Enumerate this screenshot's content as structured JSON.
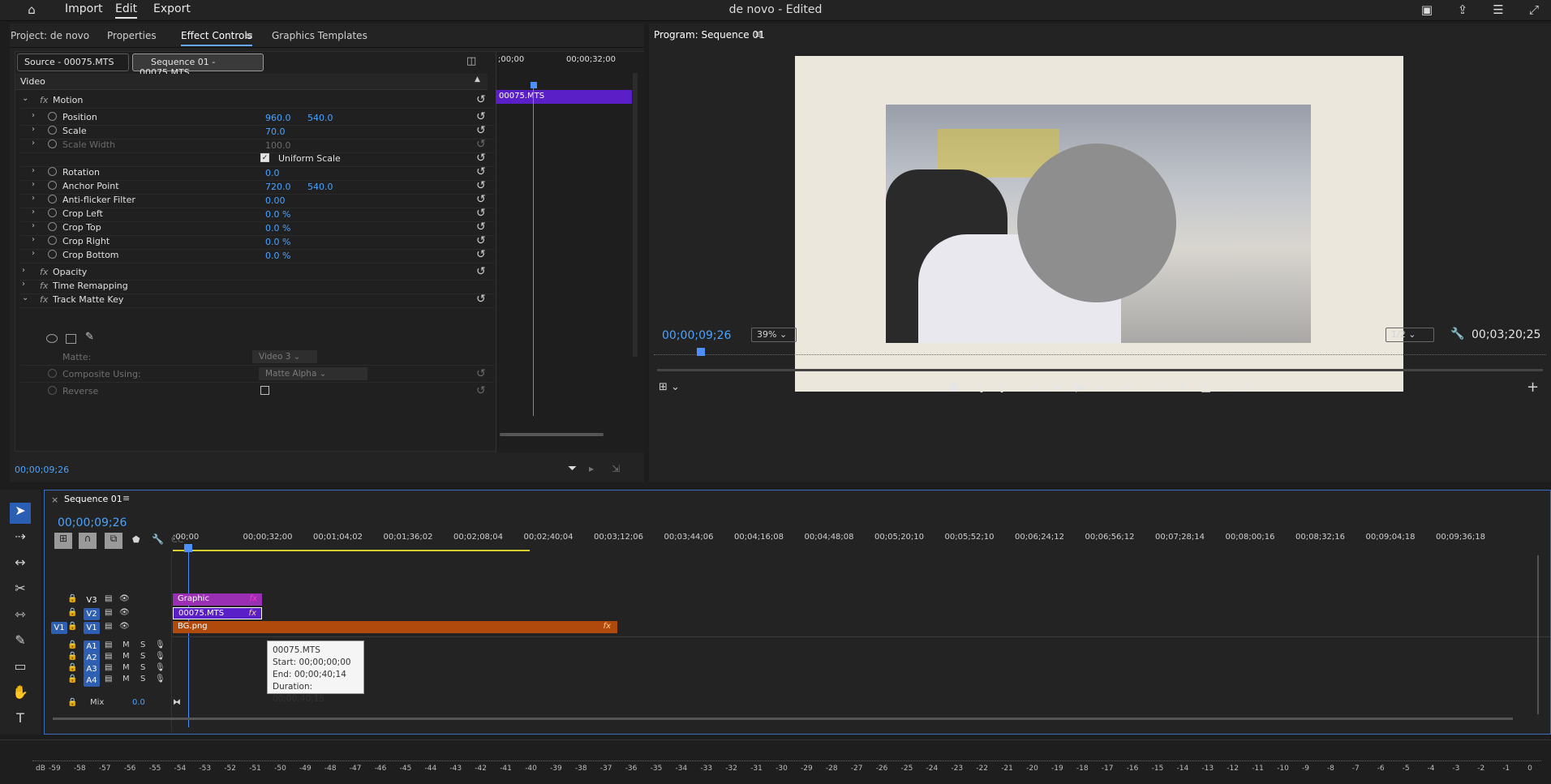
{
  "topbar": {
    "home_icon": "home-icon",
    "menu": [
      "Import",
      "Edit",
      "Export"
    ],
    "active": "Edit",
    "title": "de novo - Edited"
  },
  "left_panel": {
    "tabs": [
      "Project: de novo",
      "Properties",
      "Effect Controls",
      "Graphics Templates"
    ],
    "active_tab": "Effect Controls",
    "source_btn": "Source - 00075.MTS",
    "sequence_btn": "Sequence 01 - 00075.MTS",
    "section": "Video",
    "ec_time_start": ";00;00",
    "ec_time_end": "00;00;32;00",
    "ec_clip": "00075.MTS",
    "rows": [
      {
        "label": "Motion",
        "fx": true
      },
      {
        "label": "Position",
        "v1": "960.0",
        "v2": "540.0"
      },
      {
        "label": "Scale",
        "v1": "70.0"
      },
      {
        "label": "Scale Width",
        "v1": "100.0",
        "dim": true
      },
      {
        "label": "Uniform Scale",
        "checkbox": true
      },
      {
        "label": "Rotation",
        "v1": "0.0"
      },
      {
        "label": "Anchor Point",
        "v1": "720.0",
        "v2": "540.0"
      },
      {
        "label": "Anti-flicker Filter",
        "v1": "0.00"
      },
      {
        "label": "Crop Left",
        "v1": "0.0 %"
      },
      {
        "label": "Crop Top",
        "v1": "0.0 %"
      },
      {
        "label": "Crop Right",
        "v1": "0.0 %"
      },
      {
        "label": "Crop Bottom",
        "v1": "0.0 %"
      },
      {
        "label": "Opacity",
        "fx": true
      },
      {
        "label": "Time Remapping",
        "fx": true
      },
      {
        "label": "Track Matte Key",
        "fx": true
      }
    ],
    "matte_label": "Matte:",
    "matte_value": "Video 3",
    "composite_label": "Composite Using:",
    "composite_value": "Matte Alpha",
    "reverse_label": "Reverse",
    "footer_time": "00;00;09;26"
  },
  "program": {
    "title": "Program: Sequence 01",
    "timecode": "00;00;09;26",
    "zoom": "39%",
    "resolution": "1/2",
    "duration": "00;03;20;25"
  },
  "timeline": {
    "title": "Sequence 01",
    "timecode": "00;00;09;26",
    "ruler": [
      ";00;00",
      "00;00;32;00",
      "00;01;04;02",
      "00;01;36;02",
      "00;02;08;04",
      "00;02;40;04",
      "00;03;12;06",
      "00;03;44;06",
      "00;04;16;08",
      "00;04;48;08",
      "00;05;20;10",
      "00;05;52;10",
      "00;06;24;12",
      "00;06;56;12",
      "00;07;28;14",
      "00;08;00;16",
      "00;08;32;16",
      "00;09;04;18",
      "00;09;36;18"
    ],
    "video_tracks": [
      "V3",
      "V2",
      "V1"
    ],
    "audio_tracks": [
      "A1",
      "A2",
      "A3",
      "A4"
    ],
    "source_patch": "V1",
    "clips": {
      "v3": "Graphic",
      "v2": "00075.MTS",
      "v1": "BG.png"
    },
    "mix_label": "Mix",
    "mix_value": "0.0",
    "m_label": "M",
    "s_label": "S",
    "tooltip": {
      "name": "00075.MTS",
      "start": "Start: 00;00;00;00",
      "end": "End: 00;00;40;14",
      "duration": "Duration: 00;00;40;15"
    }
  },
  "meter": {
    "db_label": "dB",
    "ticks": [
      "-59",
      "-58",
      "-57",
      "-56",
      "-55",
      "-54",
      "-53",
      "-52",
      "-51",
      "-50",
      "-49",
      "-48",
      "-47",
      "-46",
      "-45",
      "-44",
      "-43",
      "-42",
      "-41",
      "-40",
      "-39",
      "-38",
      "-37",
      "-36",
      "-35",
      "-34",
      "-33",
      "-32",
      "-31",
      "-30",
      "-29",
      "-28",
      "-27",
      "-26",
      "-25",
      "-24",
      "-23",
      "-22",
      "-21",
      "-20",
      "-19",
      "-18",
      "-17",
      "-16",
      "-15",
      "-14",
      "-13",
      "-12",
      "-11",
      "-10",
      "-9",
      "-8",
      "-7",
      "-6",
      "-5",
      "-4",
      "-3",
      "-2",
      "-1",
      "0"
    ]
  }
}
